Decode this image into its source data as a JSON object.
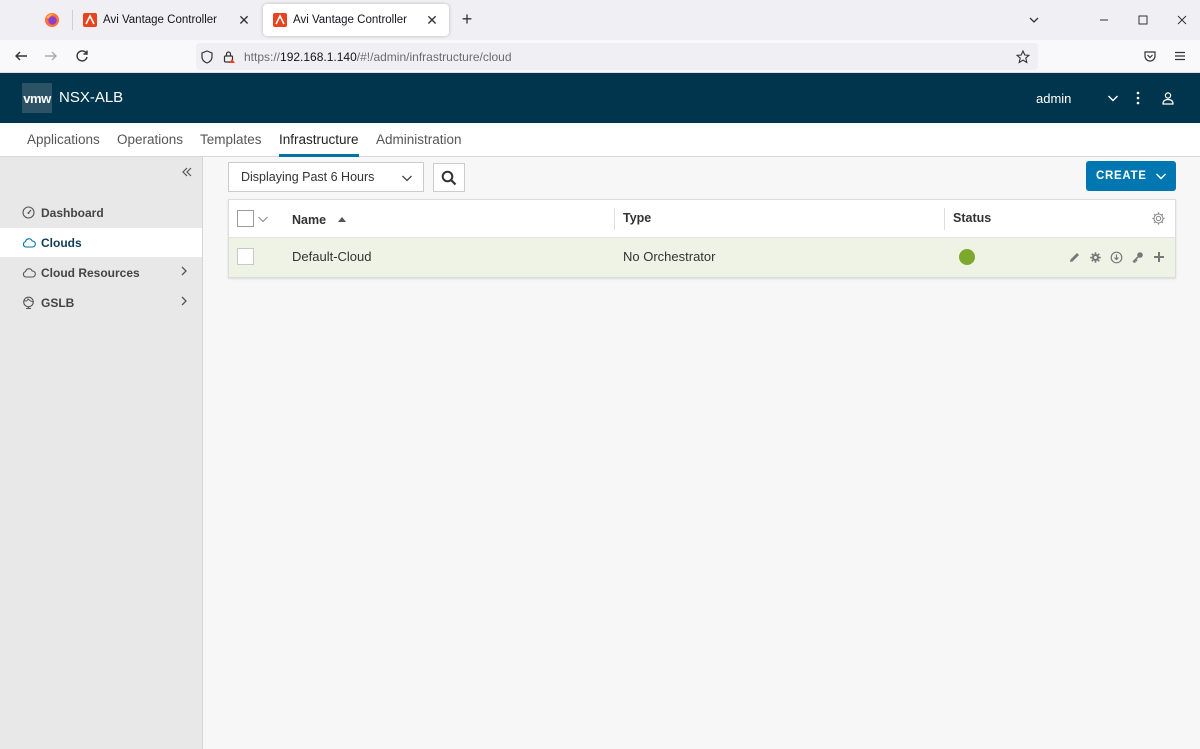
{
  "browser": {
    "tabs": [
      {
        "title": "Avi Vantage Controller",
        "active": false
      },
      {
        "title": "Avi Vantage Controller",
        "active": true
      }
    ],
    "url_prefix": "https://",
    "url_host": "192.168.1.140",
    "url_path": "/#!/admin/infrastructure/cloud"
  },
  "header": {
    "logo": "vmw",
    "product": "NSX-ALB",
    "user": "admin"
  },
  "main_nav": [
    {
      "label": "Applications",
      "active": false
    },
    {
      "label": "Operations",
      "active": false
    },
    {
      "label": "Templates",
      "active": false
    },
    {
      "label": "Infrastructure",
      "active": true
    },
    {
      "label": "Administration",
      "active": false
    }
  ],
  "sidebar": {
    "items": [
      {
        "label": "Dashboard",
        "icon": "dashboard-icon",
        "selected": false,
        "expandable": false
      },
      {
        "label": "Clouds",
        "icon": "cloud-icon",
        "selected": true,
        "expandable": false
      },
      {
        "label": "Cloud Resources",
        "icon": "cloud-resources-icon",
        "selected": false,
        "expandable": true
      },
      {
        "label": "GSLB",
        "icon": "globe-icon",
        "selected": false,
        "expandable": true
      }
    ]
  },
  "toolbar": {
    "time_range": "Displaying Past 6 Hours",
    "create_label": "CREATE"
  },
  "grid": {
    "columns": [
      {
        "label": "Name",
        "sorted": "asc"
      },
      {
        "label": "Type"
      },
      {
        "label": "Status"
      }
    ],
    "rows": [
      {
        "name": "Default-Cloud",
        "type": "No Orchestrator",
        "status": "up",
        "status_color": "#7ca82b"
      }
    ]
  },
  "colors": {
    "header_bg": "#00364d",
    "accent": "#0077b0",
    "status_ok": "#7ca82b"
  }
}
